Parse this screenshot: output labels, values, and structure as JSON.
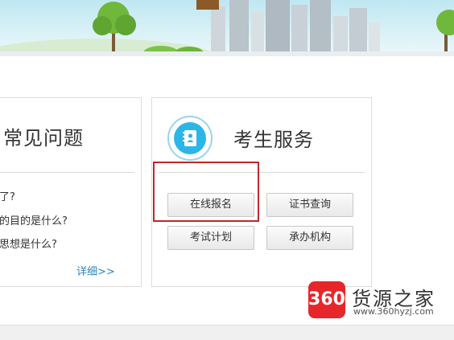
{
  "faq": {
    "title": "常见问题",
    "items": [
      "了?",
      "的目的是什么?",
      "思想是什么?"
    ],
    "more": "详细>>"
  },
  "services": {
    "title": "考生服务",
    "icon": "contact-book-icon",
    "buttons": [
      "在线报名",
      "证书查询",
      "考试计划",
      "承办机构"
    ]
  },
  "watermark": {
    "logo_text": "360",
    "title": "货源之家",
    "url": "www.360hyzj.com"
  },
  "colors": {
    "highlight": "#c0272d",
    "link": "#2a84c6",
    "accent": "#2cb6e8"
  }
}
